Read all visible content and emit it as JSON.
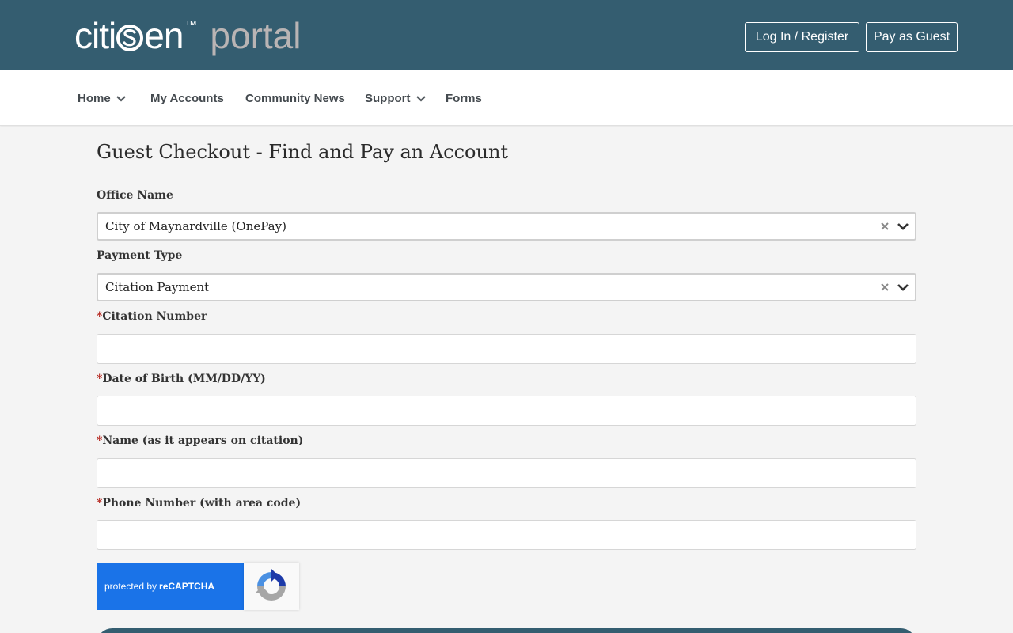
{
  "header": {
    "brand_pre": "citi",
    "brand_post": "en",
    "trademark": "™",
    "portal": "portal",
    "login_label": "Log In / Register",
    "guest_label": "Pay as Guest"
  },
  "nav": {
    "items": [
      {
        "label": "Home",
        "has_dropdown": true
      },
      {
        "label": "My Accounts",
        "has_dropdown": false
      },
      {
        "label": "Community News",
        "has_dropdown": false
      },
      {
        "label": "Support",
        "has_dropdown": true
      },
      {
        "label": "Forms",
        "has_dropdown": false
      }
    ]
  },
  "page": {
    "title": "Guest Checkout - Find and Pay an Account"
  },
  "form": {
    "office_name_label": "Office Name",
    "office_name_value": "City of Maynardville (OnePay)",
    "payment_type_label": "Payment Type",
    "payment_type_value": "Citation Payment",
    "required_marker": "*",
    "citation_label": "Citation Number",
    "citation_value": "",
    "dob_label": "Date of Birth (MM/DD/YY)",
    "dob_value": "",
    "name_label": "Name (as it appears on citation)",
    "name_value": "",
    "phone_label": "Phone Number (with area code)",
    "phone_value": ""
  },
  "recaptcha": {
    "text_prefix": "protected by",
    "text_brand": "reCAPTCHA"
  },
  "colors": {
    "header_bg": "#345d70",
    "portal_text": "#b9b4b4",
    "required": "#b5261e",
    "recaptcha_blue": "#1a73e8"
  },
  "icons": {
    "chevron": "chevron-down-icon",
    "clear": "clear-x-icon",
    "recaptcha": "recaptcha-logo-icon"
  }
}
